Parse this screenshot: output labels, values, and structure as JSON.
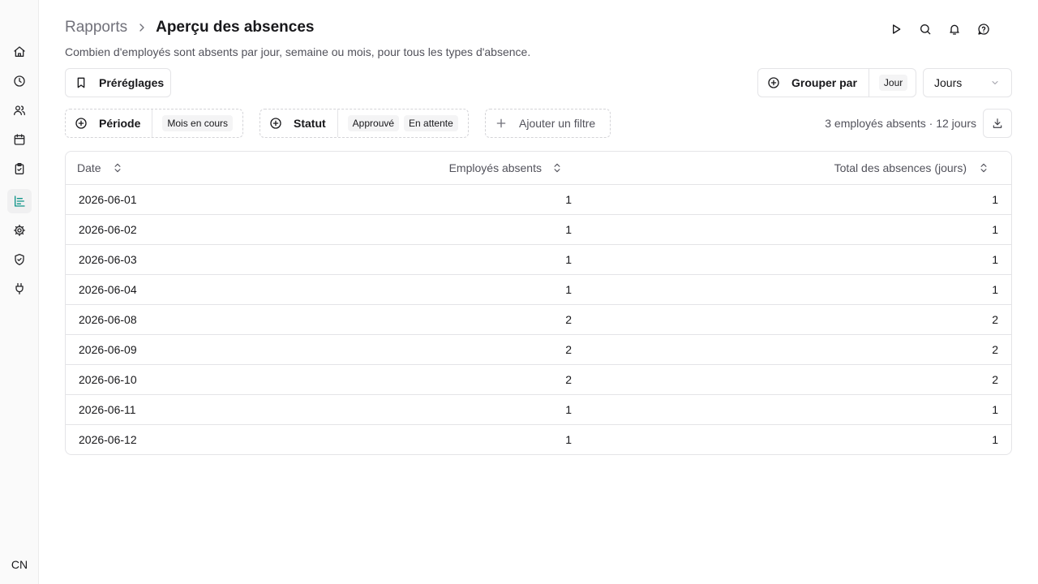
{
  "sidebar": {
    "items": [
      {
        "icon": "home-icon",
        "name": "home"
      },
      {
        "icon": "clock-icon",
        "name": "time"
      },
      {
        "icon": "users-icon",
        "name": "employees"
      },
      {
        "icon": "calendar-icon",
        "name": "calendar"
      },
      {
        "icon": "clipboard-check-icon",
        "name": "approvals"
      },
      {
        "icon": "chart-bar-icon",
        "name": "reports"
      },
      {
        "icon": "gear-icon",
        "name": "settings"
      },
      {
        "icon": "shield-check-icon",
        "name": "security"
      },
      {
        "icon": "plug-icon",
        "name": "integrations"
      }
    ],
    "active": "reports",
    "avatar_initials": "CN",
    "accent": "#0d9488"
  },
  "header": {
    "breadcrumb_parent": "Rapports",
    "title": "Aperçu des absences",
    "subtitle": "Combien d'employés sont absents par jour, semaine ou mois, pour tous les types d'absence.",
    "icons": [
      "play-icon",
      "search-icon",
      "bell-icon",
      "help-circle-icon"
    ]
  },
  "toolbar": {
    "presets_label": "Préréglages",
    "groupby_label": "Grouper par",
    "groupby_value": "Jour",
    "unit_select_value": "Jours"
  },
  "filters": {
    "periode_label": "Période",
    "periode_value": "Mois en cours",
    "statut_label": "Statut",
    "statut_values": [
      "Approuvé",
      "En attente"
    ],
    "add_filter_label": "Ajouter un filtre"
  },
  "summary": "3 employés absents · 12 jours",
  "table": {
    "columns": [
      "Date",
      "Employés absents",
      "Total des absences (jours)"
    ],
    "rows": [
      [
        "2026-06-01",
        "1",
        "1"
      ],
      [
        "2026-06-02",
        "1",
        "1"
      ],
      [
        "2026-06-03",
        "1",
        "1"
      ],
      [
        "2026-06-04",
        "1",
        "1"
      ],
      [
        "2026-06-08",
        "2",
        "2"
      ],
      [
        "2026-06-09",
        "2",
        "2"
      ],
      [
        "2026-06-10",
        "2",
        "2"
      ],
      [
        "2026-06-11",
        "1",
        "1"
      ],
      [
        "2026-06-12",
        "1",
        "1"
      ]
    ]
  }
}
